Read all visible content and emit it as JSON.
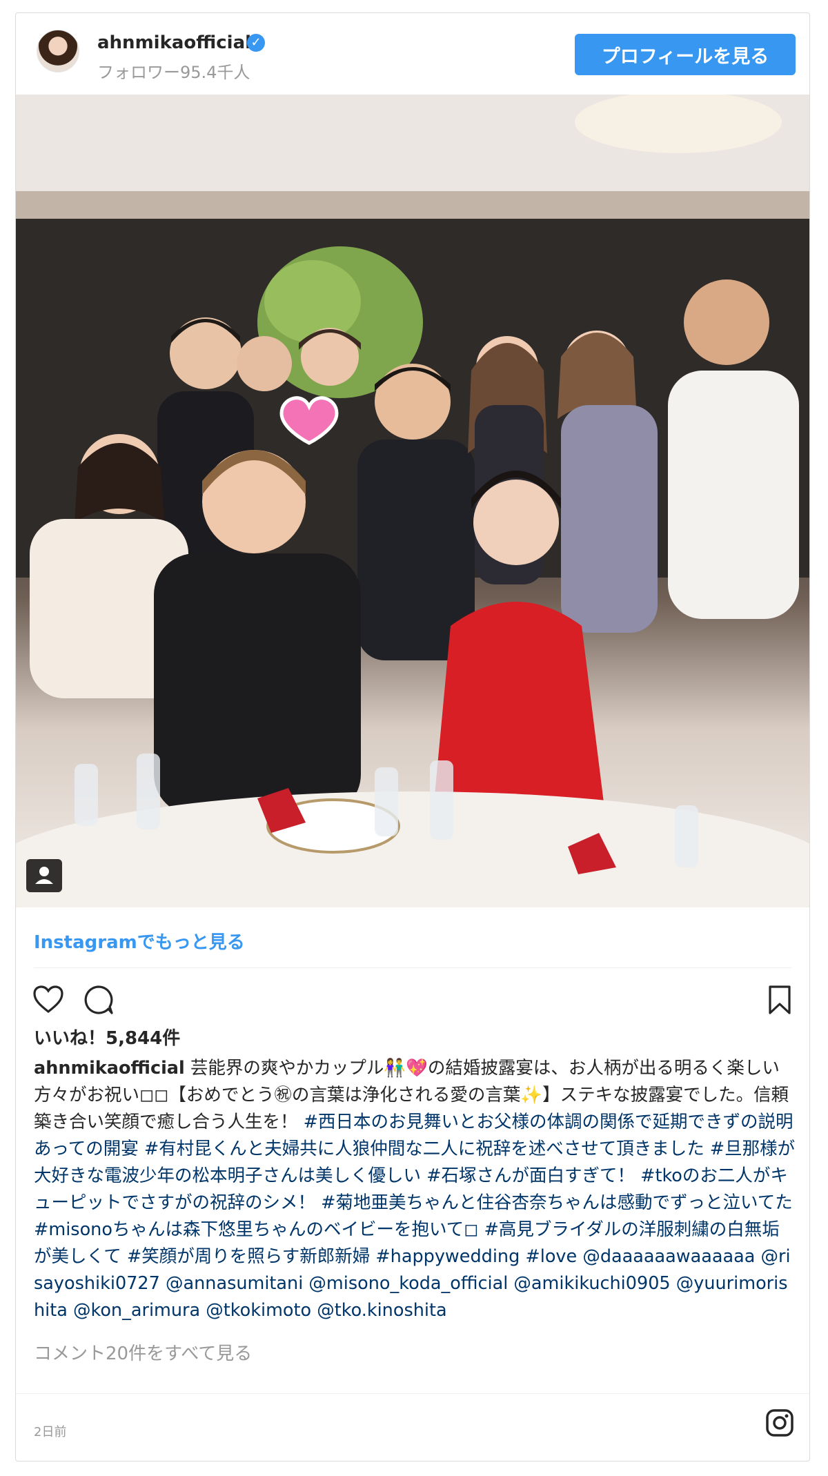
{
  "header": {
    "username": "ahnmikaofficial",
    "verified": "✓",
    "followers": "フォロワー95.4千人",
    "profile_button": "プロフィールを見る"
  },
  "photo": {
    "user_tag_icon": "person-icon"
  },
  "more_link": "Instagramでもっと見る",
  "actions": {
    "like_icon": "heart-icon",
    "comment_icon": "comment-icon",
    "save_icon": "bookmark-icon"
  },
  "likes": "いいね！5,844件",
  "caption": {
    "username": "ahnmikaofficial",
    "text": "芸能界の爽やかカップル👫💖の結婚披露宴は、お人柄が出る明るく楽しい方々がお祝い◻◻【おめでとう㊗の言葉は浄化される愛の言葉✨】ステキな披露宴でした。信頼築き合い笑顔で癒し合う人生を！",
    "hashtags": "#西日本のお見舞いとお父様の体調の関係で延期できずの説明あっての開宴 #有村昆くんと夫婦共に人狼仲間な二人に祝辞を述べさせて頂きました #旦那様が大好きな電波少年の松本明子さんは美しく優しい #石塚さんが面白すぎて！ #tkoのお二人がキューピットでさすがの祝辞のシメ！ #菊地亜美ちゃんと住谷杏奈ちゃんは感動でずっと泣いてた #misonoちゃんは森下悠里ちゃんのベイビーを抱いて◻ #高見ブライダルの洋服刺繍の白無垢が美しくて #笑顔が周りを照らす新郎新婦 #happywedding #love @daaaaaawaaaaaa @risayoshiki0727 @annasumitani @misono_koda_official @amikikuchi0905 @yuurimorishita @kon_arimura @tkokimoto @tko.kinoshita"
  },
  "comments_link": "コメント20件をすべて見る",
  "timestamp": "2日前",
  "footer_icon": "instagram-icon",
  "colors": {
    "accent": "#3897f0",
    "text": "#262626",
    "muted": "#999999"
  }
}
